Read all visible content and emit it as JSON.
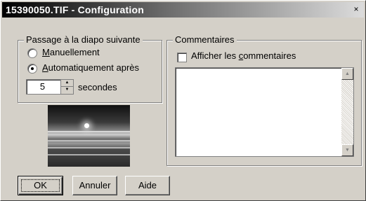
{
  "window": {
    "title": "15390050.TIF - Configuration",
    "close_glyph": "×"
  },
  "slideshow": {
    "group_label": "Passage à la diapo suivante",
    "manual_label": "Manuellement",
    "manual_underline": "M",
    "manual_rest": "anuellement",
    "auto_underline": "A",
    "auto_rest": "utomatiquement après",
    "auto_label": "Automatiquement après",
    "selected": "auto",
    "seconds_value": "5",
    "seconds_label": "secondes"
  },
  "comments": {
    "group_label": "Commentaires",
    "show_pre": "Afficher les ",
    "show_underline": "c",
    "show_rest": "ommentaires",
    "show_label": "Afficher les commentaires",
    "show_checked": false,
    "text": ""
  },
  "buttons": {
    "ok": "OK",
    "cancel": "Annuler",
    "help": "Aide"
  },
  "icons": {
    "close": "close-icon",
    "spin_up": "arrow-up-icon",
    "spin_down": "arrow-down-icon",
    "scroll_up": "scroll-up-icon",
    "scroll_down": "scroll-down-icon"
  }
}
